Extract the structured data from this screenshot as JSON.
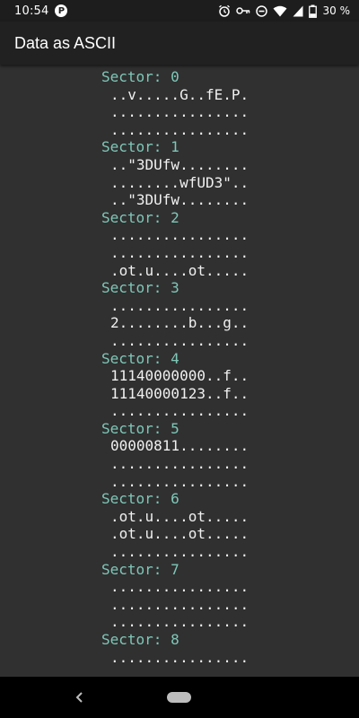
{
  "status_bar": {
    "time": "10:54",
    "app_icon": "P",
    "battery": "30 %",
    "icons": [
      "alarm-icon",
      "key-icon",
      "do-not-disturb-icon",
      "wifi-icon",
      "signal-icon",
      "battery-icon"
    ]
  },
  "app_bar": {
    "title": "Data as ASCII"
  },
  "sectors": [
    {
      "title": "Sector: 0",
      "lines": [
        "..v.....G..fE.P.",
        "................",
        "................"
      ]
    },
    {
      "title": "Sector: 1",
      "lines": [
        "..\"3DUfw........",
        "........wfUD3\"..",
        "..\"3DUfw........"
      ]
    },
    {
      "title": "Sector: 2",
      "lines": [
        "................",
        "................",
        ".ot.u....ot....."
      ]
    },
    {
      "title": "Sector: 3",
      "lines": [
        "................",
        "2........b...g..",
        "................"
      ]
    },
    {
      "title": "Sector: 4",
      "lines": [
        "11140000000..f..",
        "11140000123..f..",
        "................"
      ]
    },
    {
      "title": "Sector: 5",
      "lines": [
        "00000811........",
        "................",
        "................"
      ]
    },
    {
      "title": "Sector: 6",
      "lines": [
        ".ot.u....ot.....",
        ".ot.u....ot.....",
        "................"
      ]
    },
    {
      "title": "Sector: 7",
      "lines": [
        "................",
        "................",
        "................"
      ]
    },
    {
      "title": "Sector: 8",
      "lines": [
        "................"
      ]
    }
  ],
  "nav_bar": {
    "back_icon": "back-icon",
    "home_icon": "home-pill-icon"
  },
  "colors": {
    "sector_title": "#7fc7b8",
    "background": "#303030",
    "app_bar": "#212121"
  }
}
